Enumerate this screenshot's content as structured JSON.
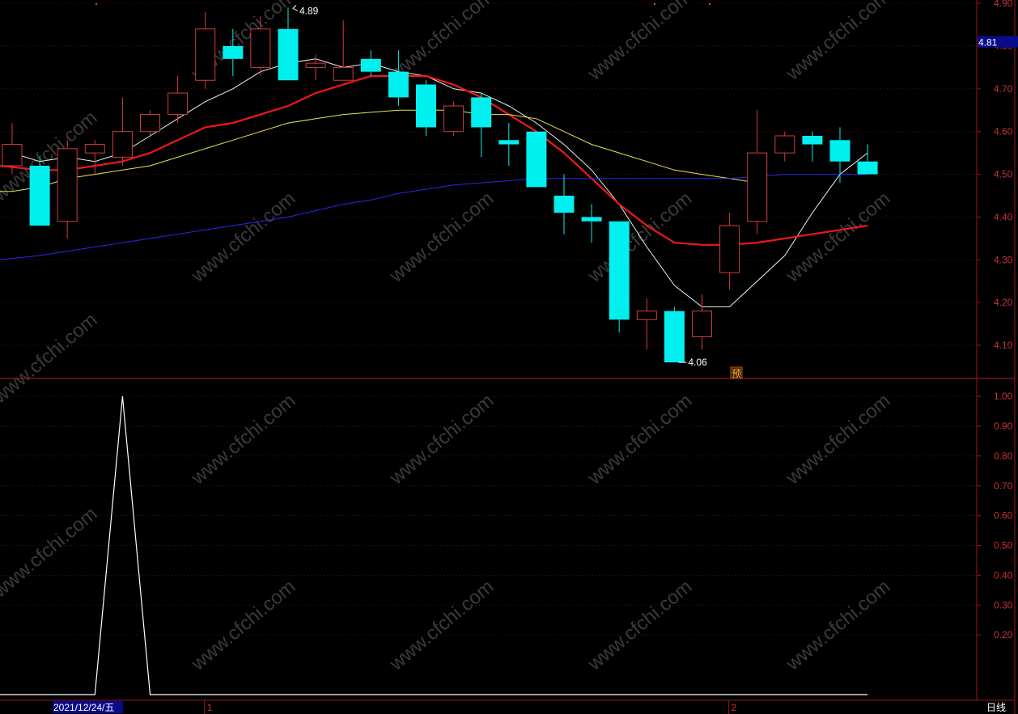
{
  "watermark": "www.cfchi.com",
  "colors": {
    "up": "#d23c3c",
    "down": "#00f0f0",
    "ma5": "#f0f0f0",
    "ma10": "#f01818",
    "ma20": "#e6e650",
    "ma60": "#2828f0",
    "axis": "#a01414",
    "tick_text": "#c83232",
    "indicator": "#ffffff",
    "current_price_bg": "#0a0a8c"
  },
  "chart_data": [
    {
      "type": "candlestick",
      "title": "",
      "ylim": [
        4.02,
        4.91
      ],
      "y_ticks": [
        "4.10",
        "4.20",
        "4.30",
        "4.40",
        "4.50",
        "4.60",
        "4.70",
        "4.80",
        "4.90"
      ],
      "current_price_label": "4.81",
      "annotations": {
        "high": "4.89",
        "low": "4.06",
        "forecast_marker": "预"
      },
      "candles": [
        {
          "o": 4.52,
          "h": 4.62,
          "l": 4.5,
          "c": 4.57
        },
        {
          "o": 4.52,
          "h": 4.54,
          "l": 4.38,
          "c": 4.38
        },
        {
          "o": 4.39,
          "h": 4.58,
          "l": 4.35,
          "c": 4.56
        },
        {
          "o": 4.55,
          "h": 4.58,
          "l": 4.5,
          "c": 4.57
        },
        {
          "o": 4.54,
          "h": 4.68,
          "l": 4.52,
          "c": 4.6
        },
        {
          "o": 4.6,
          "h": 4.65,
          "l": 4.59,
          "c": 4.64
        },
        {
          "o": 4.64,
          "h": 4.73,
          "l": 4.62,
          "c": 4.69
        },
        {
          "o": 4.72,
          "h": 4.88,
          "l": 4.7,
          "c": 4.84
        },
        {
          "o": 4.8,
          "h": 4.84,
          "l": 4.73,
          "c": 4.77
        },
        {
          "o": 4.75,
          "h": 4.87,
          "l": 4.73,
          "c": 4.84
        },
        {
          "o": 4.84,
          "h": 4.89,
          "l": 4.72,
          "c": 4.72
        },
        {
          "o": 4.75,
          "h": 4.78,
          "l": 4.72,
          "c": 4.76
        },
        {
          "o": 4.72,
          "h": 4.86,
          "l": 4.72,
          "c": 4.75
        },
        {
          "o": 4.77,
          "h": 4.79,
          "l": 4.73,
          "c": 4.74
        },
        {
          "o": 4.74,
          "h": 4.79,
          "l": 4.66,
          "c": 4.68
        },
        {
          "o": 4.71,
          "h": 4.72,
          "l": 4.59,
          "c": 4.61
        },
        {
          "o": 4.6,
          "h": 4.67,
          "l": 4.59,
          "c": 4.66
        },
        {
          "o": 4.68,
          "h": 4.69,
          "l": 4.54,
          "c": 4.61
        },
        {
          "o": 4.58,
          "h": 4.62,
          "l": 4.52,
          "c": 4.57
        },
        {
          "o": 4.6,
          "h": 4.6,
          "l": 4.47,
          "c": 4.47
        },
        {
          "o": 4.45,
          "h": 4.5,
          "l": 4.36,
          "c": 4.41
        },
        {
          "o": 4.4,
          "h": 4.43,
          "l": 4.34,
          "c": 4.39
        },
        {
          "o": 4.39,
          "h": 4.39,
          "l": 4.13,
          "c": 4.16
        },
        {
          "o": 4.16,
          "h": 4.21,
          "l": 4.09,
          "c": 4.18
        },
        {
          "o": 4.18,
          "h": 4.19,
          "l": 4.06,
          "c": 4.06
        },
        {
          "o": 4.12,
          "h": 4.22,
          "l": 4.09,
          "c": 4.18
        },
        {
          "o": 4.27,
          "h": 4.41,
          "l": 4.23,
          "c": 4.38
        },
        {
          "o": 4.39,
          "h": 4.65,
          "l": 4.36,
          "c": 4.55
        },
        {
          "o": 4.55,
          "h": 4.6,
          "l": 4.53,
          "c": 4.59
        },
        {
          "o": 4.59,
          "h": 4.6,
          "l": 4.53,
          "c": 4.57
        },
        {
          "o": 4.58,
          "h": 4.61,
          "l": 4.48,
          "c": 4.53
        },
        {
          "o": 4.53,
          "h": 4.57,
          "l": 4.5,
          "c": 4.5
        }
      ],
      "series": [
        {
          "key": "ma5",
          "values": [
            4.55,
            4.53,
            4.54,
            4.53,
            4.55,
            4.59,
            4.63,
            4.67,
            4.7,
            4.74,
            4.76,
            4.77,
            4.75,
            4.76,
            4.74,
            4.73,
            4.7,
            4.69,
            4.66,
            4.62,
            4.57,
            4.51,
            4.43,
            4.33,
            4.24,
            4.19,
            4.19,
            4.25,
            4.31,
            4.41,
            4.5,
            4.55
          ]
        },
        {
          "key": "ma10",
          "values": [
            4.52,
            4.51,
            4.51,
            4.52,
            4.53,
            4.55,
            4.58,
            4.61,
            4.62,
            4.64,
            4.66,
            4.69,
            4.71,
            4.73,
            4.73,
            4.73,
            4.71,
            4.68,
            4.64,
            4.6,
            4.55,
            4.49,
            4.43,
            4.38,
            4.34,
            4.335,
            4.335,
            4.34,
            4.35,
            4.36,
            4.37,
            4.38
          ]
        },
        {
          "key": "ma20",
          "values": [
            4.46,
            4.47,
            4.49,
            4.5,
            4.51,
            4.52,
            4.54,
            4.56,
            4.58,
            4.6,
            4.62,
            4.63,
            4.64,
            4.645,
            4.65,
            4.65,
            4.65,
            4.64,
            4.64,
            4.63,
            4.6,
            4.57,
            4.55,
            4.53,
            4.51,
            4.5,
            4.49,
            4.48
          ]
        },
        {
          "key": "ma60",
          "values": [
            4.3,
            4.31,
            4.32,
            4.33,
            4.34,
            4.35,
            4.36,
            4.37,
            4.38,
            4.39,
            4.4,
            4.415,
            4.43,
            4.44,
            4.455,
            4.465,
            4.475,
            4.48,
            4.485,
            4.49,
            4.49,
            4.49,
            4.49,
            4.49,
            4.49,
            4.49,
            4.49,
            4.495,
            4.5,
            4.5,
            4.5,
            4.5
          ]
        }
      ]
    },
    {
      "type": "line",
      "title": "",
      "ylim": [
        0,
        1.1
      ],
      "y_ticks": [
        "1.00",
        "0.90",
        "0.80",
        "0.70",
        "0.60",
        "0.50",
        "0.40",
        "0.30",
        "0.20"
      ],
      "series": [
        {
          "values": [
            0,
            0,
            0,
            0,
            1,
            0,
            0,
            0,
            0,
            0,
            0,
            0,
            0,
            0,
            0,
            0,
            0,
            0,
            0,
            0,
            0,
            0,
            0,
            0,
            0,
            0,
            0,
            0,
            0,
            0,
            0,
            0
          ]
        }
      ]
    }
  ],
  "x_axis": {
    "date_label": "2021/12/24/五",
    "month_markers": [
      {
        "index": 7,
        "label": "1"
      },
      {
        "index": 26,
        "label": "2"
      }
    ]
  },
  "period_label": "日线"
}
